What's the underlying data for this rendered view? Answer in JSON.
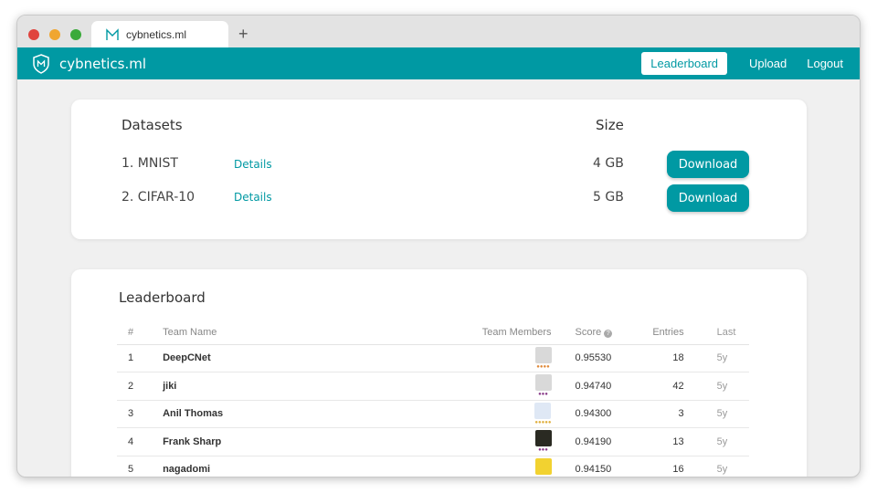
{
  "browser": {
    "tab_title": "cybnetics.ml",
    "new_tab_symbol": "+"
  },
  "nav": {
    "brand": "cybnetics.ml",
    "links": [
      "Leaderboard",
      "Upload",
      "Logout"
    ],
    "accent_color": "#0099a3"
  },
  "datasets": {
    "header_name": "Datasets",
    "header_size": "Size",
    "rows": [
      {
        "name": "1. MNIST",
        "details": "Details",
        "size": "4 GB",
        "action": "Download"
      },
      {
        "name": "2. CIFAR-10",
        "details": "Details",
        "size": "5 GB",
        "action": "Download"
      }
    ]
  },
  "leaderboard": {
    "title": "Leaderboard",
    "columns": [
      "#",
      "Team Name",
      "Team Members",
      "Score",
      "Entries",
      "Last"
    ],
    "rows": [
      {
        "rank": "1",
        "team": "DeepCNet",
        "score": "0.95530",
        "entries": "18",
        "last": "5y",
        "avatar_color": "#d9d9d9",
        "dots": "●●●●",
        "dot_color": "#e08a3a"
      },
      {
        "rank": "2",
        "team": "jiki",
        "score": "0.94740",
        "entries": "42",
        "last": "5y",
        "avatar_color": "#d9d9d9",
        "dots": "●●●",
        "dot_color": "#8a3d8a"
      },
      {
        "rank": "3",
        "team": "Anil Thomas",
        "score": "0.94300",
        "entries": "3",
        "last": "5y",
        "avatar_color": "#dfe8f5",
        "dots": "●●●●●",
        "dot_color": "#e0b040"
      },
      {
        "rank": "4",
        "team": "Frank Sharp",
        "score": "0.94190",
        "entries": "13",
        "last": "5y",
        "avatar_color": "#2a2a22",
        "dots": "●●●",
        "dot_color": "#8a3d8a"
      },
      {
        "rank": "5",
        "team": "nagadomi",
        "score": "0.94150",
        "entries": "16",
        "last": "5y",
        "avatar_color": "#f2d230",
        "dots": "",
        "dot_color": "#8a3d8a"
      }
    ]
  }
}
